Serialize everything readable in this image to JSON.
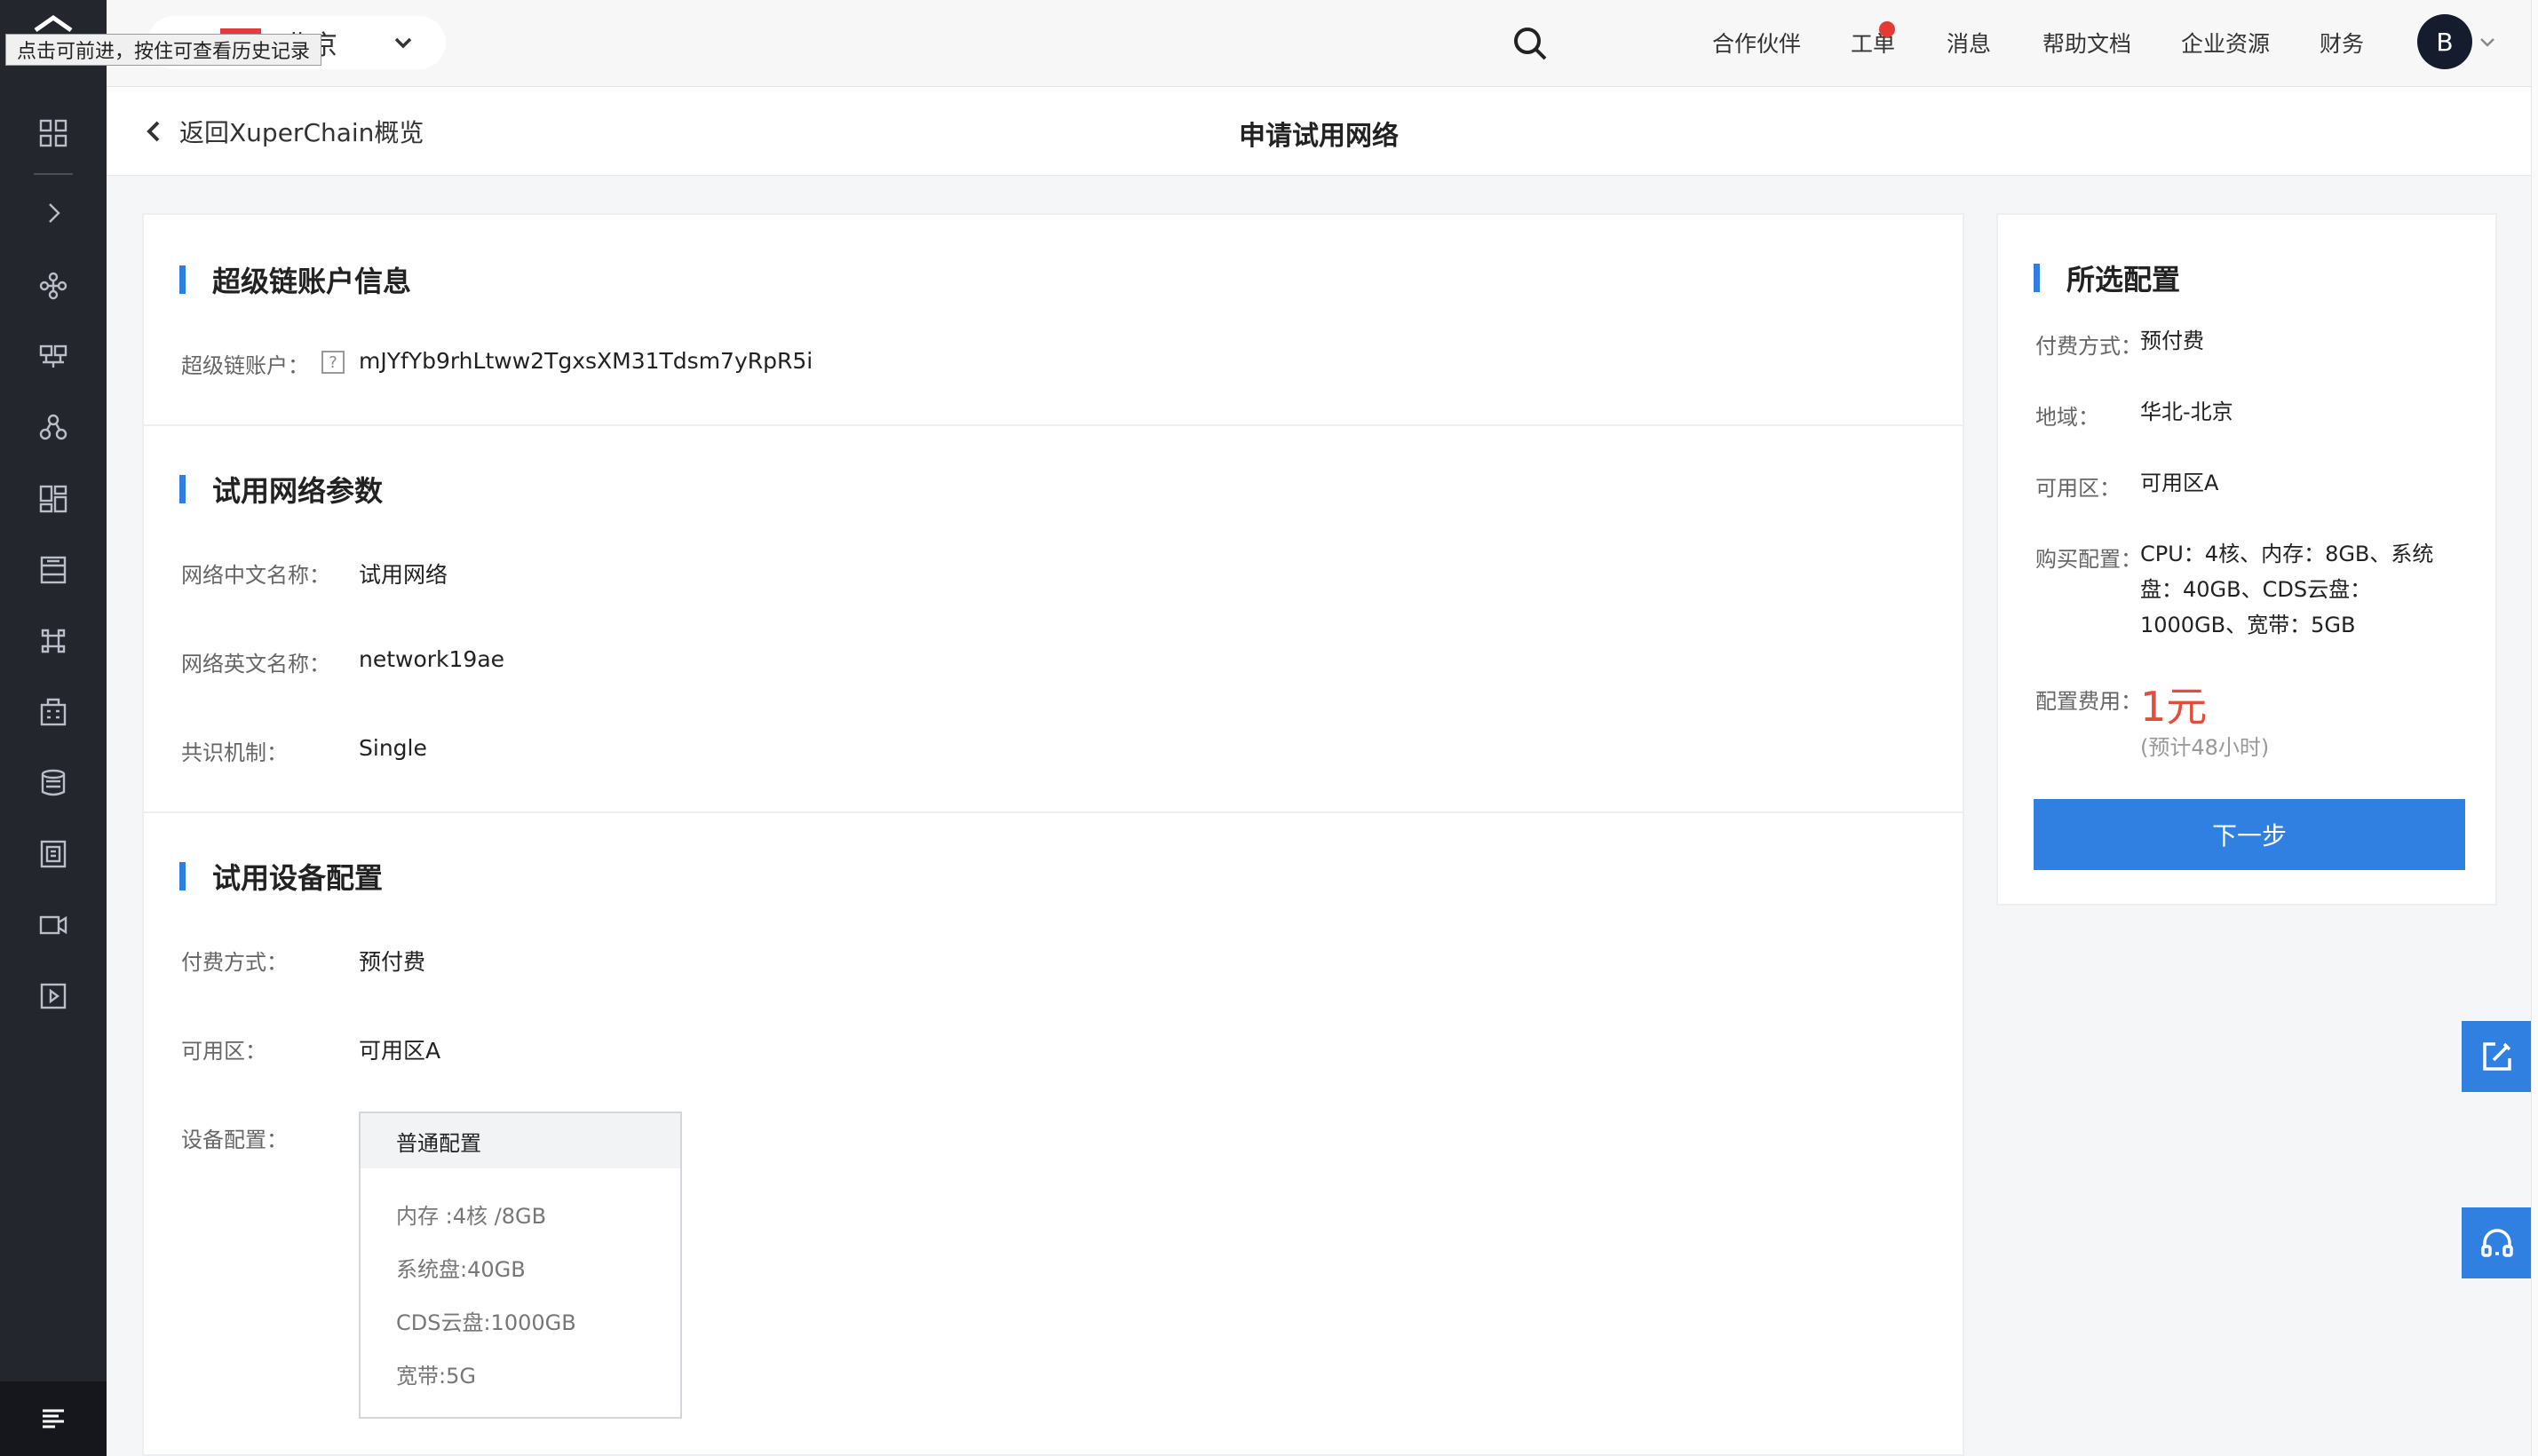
{
  "tooltip": "点击可前进，按住可查看历史记录",
  "region": {
    "label": "北京"
  },
  "topnav": {
    "items": [
      "合作伙伴",
      "工单",
      "消息",
      "帮助文档",
      "企业资源",
      "财务"
    ],
    "avatar": "B"
  },
  "page": {
    "back_label": "返回XuperChain概览",
    "title": "申请试用网络"
  },
  "account_section": {
    "title": "超级链账户信息",
    "account_label": "超级链账户：",
    "account_value": "mJYfYb9rhLtww2TgxsXM31Tdsm7yRpR5i",
    "help_icon": "?"
  },
  "network_section": {
    "title": "试用网络参数",
    "fields": [
      {
        "label": "网络中文名称：",
        "value": "试用网络"
      },
      {
        "label": "网络英文名称：",
        "value": "network19ae"
      },
      {
        "label": "共识机制：",
        "value": "Single"
      }
    ]
  },
  "device_section": {
    "title": "试用设备配置",
    "fields": [
      {
        "label": "付费方式：",
        "value": "预付费"
      },
      {
        "label": "可用区：",
        "value": "可用区A"
      },
      {
        "label": "设备配置：",
        "value": ""
      }
    ],
    "config_box": {
      "header": "普通配置",
      "lines": [
        "内存 :4核 /8GB",
        "系统盘:40GB",
        "CDS云盘:1000GB",
        "宽带:5G"
      ]
    }
  },
  "summary": {
    "title": "所选配置",
    "rows": [
      {
        "label": "付费方式：",
        "value": "预付费"
      },
      {
        "label": "地域：",
        "value": "华北-北京"
      },
      {
        "label": "可用区：",
        "value": "可用区A"
      },
      {
        "label": "购买配置：",
        "value": "CPU：4核、内存：8GB、系统盘：40GB、CDS云盘：1000GB、宽带：5GB"
      }
    ],
    "fee_label": "配置费用：",
    "fee_value": "1元",
    "fee_note": "(预计48小时)",
    "next_button": "下一步"
  },
  "colors": {
    "accent": "#2f80e0",
    "price": "#e64b3c",
    "sidebar": "#23262d"
  },
  "sidebar_icons": [
    "grid-icon",
    "chevron-right-icon",
    "network-icon",
    "org-chart-icon",
    "users-icon",
    "dashboard-icon",
    "storage-icon",
    "command-icon",
    "building-icon",
    "database-icon",
    "frame-icon",
    "video-icon",
    "play-icon",
    "menu-icon"
  ]
}
